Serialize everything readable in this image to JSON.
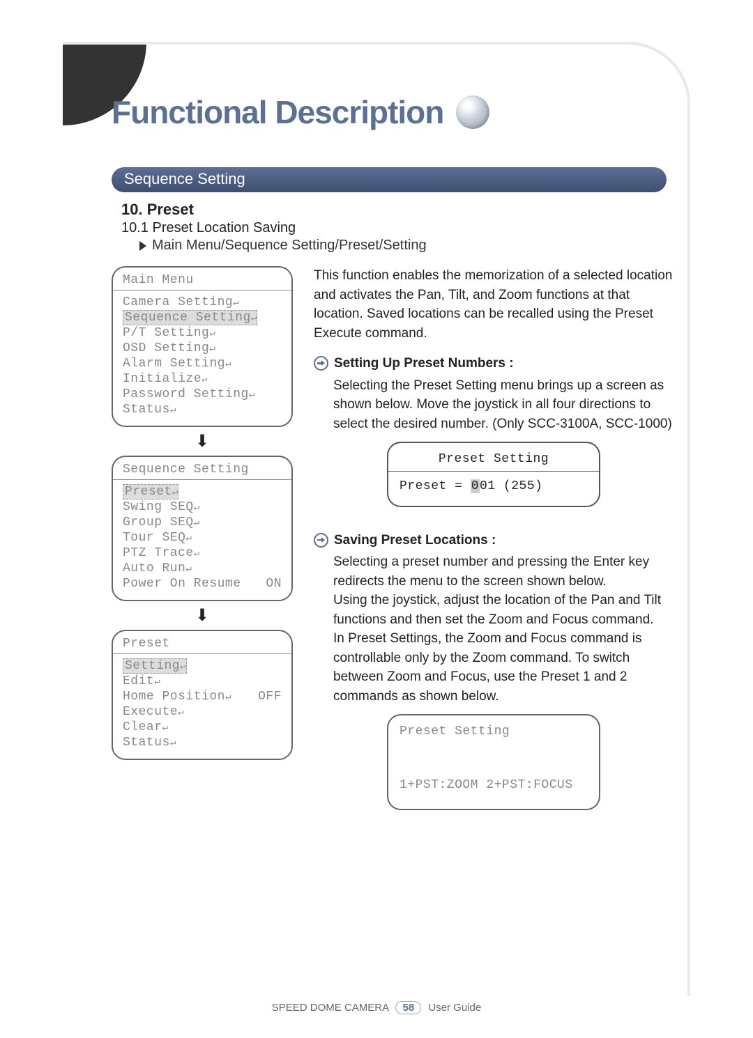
{
  "title": "Functional Description",
  "band": "Sequence Setting",
  "h10": "10. Preset",
  "sub": "10.1 Preset Location Saving",
  "crumb": "Main Menu/Sequence Setting/Preset/Setting",
  "intro": "This function enables the memorization of a selected location and activates the Pan, Tilt, and Zoom functions at that location. Saved locations can be recalled using the Preset Execute command.",
  "bullets": {
    "b1_title": "Setting Up Preset Numbers :",
    "b1_text": "Selecting the Preset Setting menu brings up a screen as shown below. Move the joystick in all four directions to select the desired number. (Only SCC-3100A, SCC-1000)",
    "b2_title": "Saving Preset Locations :",
    "b2_text": "Selecting a preset number and pressing the Enter key redirects the menu to the screen shown below.\nUsing the joystick, adjust the location of the Pan and Tilt functions and then set the Zoom and Focus command.\nIn Preset Settings, the Zoom and Focus command is controllable only by the Zoom command. To switch between Zoom and Focus, use the Preset 1 and 2 commands as shown below."
  },
  "osd_main": {
    "title": "Main Menu",
    "items": [
      "Camera Setting",
      "Sequence Setting",
      "P/T Setting",
      "OSD Setting",
      "Alarm Setting",
      "Initialize",
      "Password Setting",
      "Status"
    ],
    "selected": 1
  },
  "osd_seq": {
    "title": "Sequence Setting",
    "items": [
      {
        "label": "Preset",
        "val": ""
      },
      {
        "label": "Swing SEQ",
        "val": ""
      },
      {
        "label": "Group SEQ",
        "val": ""
      },
      {
        "label": "Tour SEQ",
        "val": ""
      },
      {
        "label": "PTZ Trace",
        "val": ""
      },
      {
        "label": "Auto Run",
        "val": ""
      },
      {
        "label": "Power On Resume",
        "val": "ON"
      }
    ],
    "selected": 0
  },
  "osd_preset": {
    "title": "Preset",
    "items": [
      {
        "label": "Setting",
        "val": ""
      },
      {
        "label": "Edit",
        "val": ""
      },
      {
        "label": "Home Position",
        "val": "OFF"
      },
      {
        "label": "Execute",
        "val": ""
      },
      {
        "label": "Clear",
        "val": ""
      },
      {
        "label": "Status",
        "val": ""
      }
    ],
    "selected": 0
  },
  "preset_setting_box": {
    "title": "Preset Setting",
    "prefix": "Preset = ",
    "num": "0",
    "rest": "01 (255)"
  },
  "preset_setting_box2": {
    "title": "Preset Setting",
    "line": "1+PST:ZOOM  2+PST:FOCUS"
  },
  "footer": {
    "left": "SPEED DOME CAMERA",
    "page": "58",
    "right": "User Guide"
  }
}
